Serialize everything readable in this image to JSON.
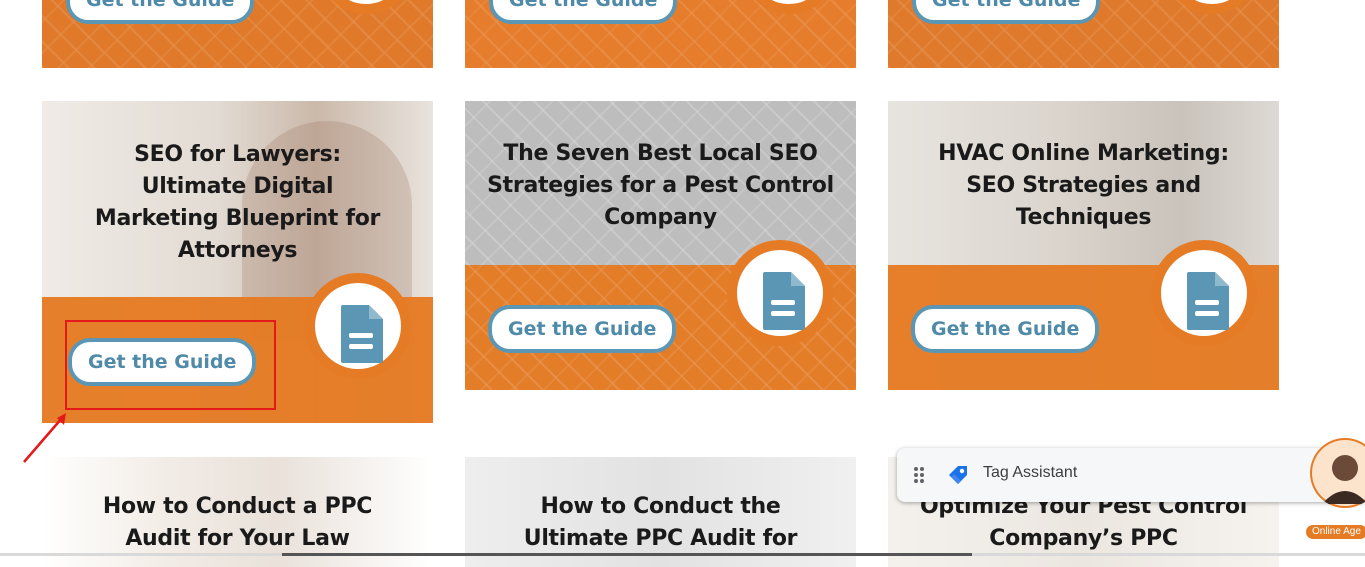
{
  "colors": {
    "accent_orange": "#e57b24",
    "button_blue": "#5b97b4",
    "annotation_red": "#e31a1a"
  },
  "top_row": [
    {
      "button_label": "Get the Guide"
    },
    {
      "button_label": "Get the Guide"
    },
    {
      "button_label": "Get the Guide"
    }
  ],
  "middle_row": [
    {
      "title": "SEO for Lawyers: Ultimate Digital Marketing Blueprint for Attorneys",
      "button_label": "Get the Guide"
    },
    {
      "title": "The Seven Best Local SEO Strategies for a Pest Control Company",
      "button_label": "Get the Guide"
    },
    {
      "title": "HVAC Online Marketing: SEO Strategies and Techniques",
      "button_label": "Get the Guide"
    }
  ],
  "bottom_row": [
    {
      "title": "How to Conduct a PPC Audit for Your Law"
    },
    {
      "title": "How to Conduct the Ultimate PPC Audit for"
    },
    {
      "title": "Optimize Your Pest Control Company’s PPC"
    }
  ],
  "tag_assistant": {
    "label": "Tag Assistant",
    "close_glyph": "×",
    "icon": "tag-assistant-icon"
  },
  "chat_widget": {
    "badge_label": "Online Age"
  }
}
